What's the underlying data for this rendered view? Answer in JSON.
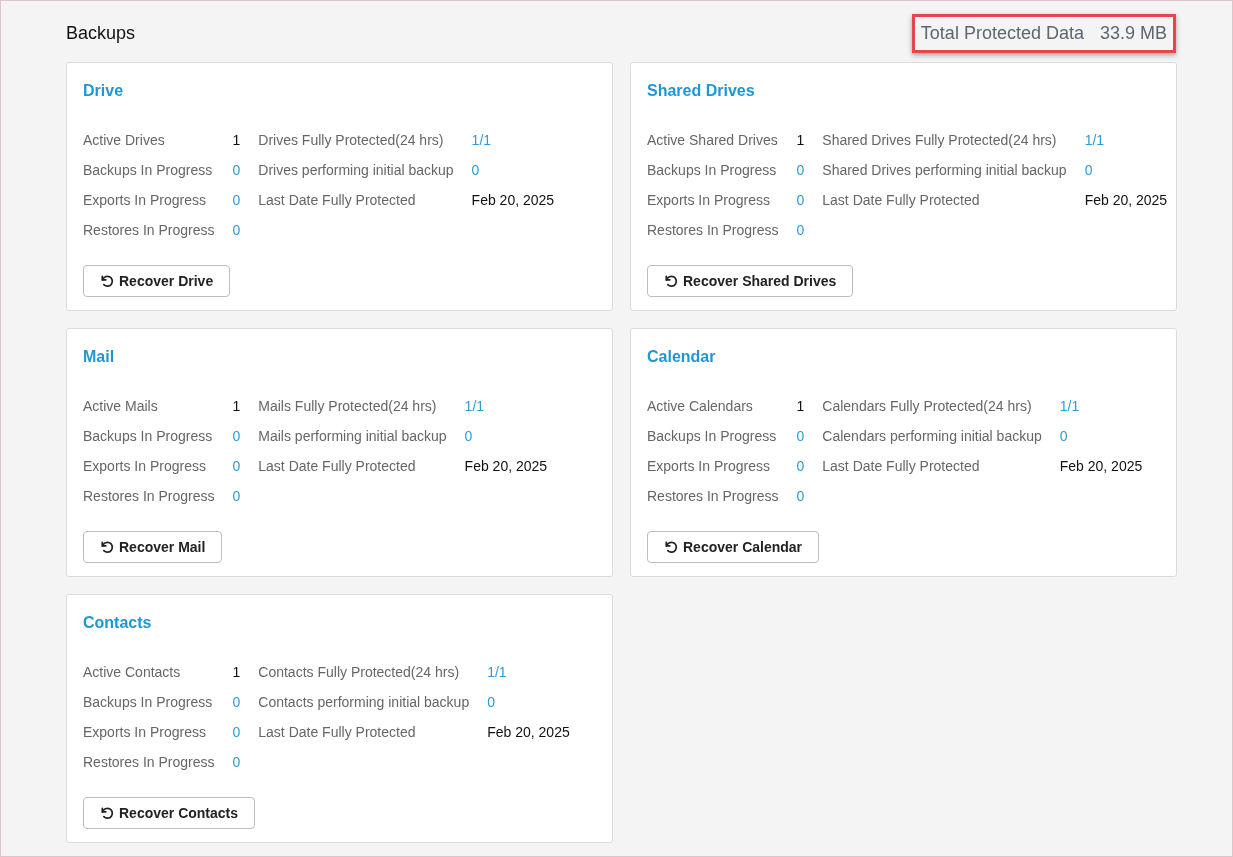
{
  "page_title": "Backups",
  "total": {
    "label": "Total Protected Data",
    "value": "33.9 MB",
    "highlighted": true
  },
  "cards": [
    {
      "title": "Drive",
      "left": [
        {
          "label": "Active Drives",
          "value": "1",
          "kind": "plain"
        },
        {
          "label": "Backups In Progress",
          "value": "0",
          "kind": "link"
        },
        {
          "label": "Exports In Progress",
          "value": "0",
          "kind": "link"
        },
        {
          "label": "Restores In Progress",
          "value": "0",
          "kind": "link"
        }
      ],
      "right": [
        {
          "label": "Drives Fully Protected(24 hrs)",
          "value": "1/1",
          "kind": "link"
        },
        {
          "label": "Drives performing initial backup",
          "value": "0",
          "kind": "link"
        },
        {
          "label": "Last Date Fully Protected",
          "value": "Feb 20, 2025",
          "kind": "plain"
        }
      ],
      "button": "Recover Drive"
    },
    {
      "title": "Shared Drives",
      "left": [
        {
          "label": "Active Shared Drives",
          "value": "1",
          "kind": "plain"
        },
        {
          "label": "Backups In Progress",
          "value": "0",
          "kind": "link"
        },
        {
          "label": "Exports In Progress",
          "value": "0",
          "kind": "link"
        },
        {
          "label": "Restores In Progress",
          "value": "0",
          "kind": "link"
        }
      ],
      "right": [
        {
          "label": "Shared Drives Fully Protected(24 hrs)",
          "value": "1/1",
          "kind": "link"
        },
        {
          "label": "Shared Drives performing initial backup",
          "value": "0",
          "kind": "link"
        },
        {
          "label": "Last Date Fully Protected",
          "value": "Feb 20, 2025",
          "kind": "plain"
        }
      ],
      "button": "Recover Shared Drives"
    },
    {
      "title": "Mail",
      "left": [
        {
          "label": "Active Mails",
          "value": "1",
          "kind": "plain"
        },
        {
          "label": "Backups In Progress",
          "value": "0",
          "kind": "link"
        },
        {
          "label": "Exports In Progress",
          "value": "0",
          "kind": "link"
        },
        {
          "label": "Restores In Progress",
          "value": "0",
          "kind": "link"
        }
      ],
      "right": [
        {
          "label": "Mails Fully Protected(24 hrs)",
          "value": "1/1",
          "kind": "link"
        },
        {
          "label": "Mails performing initial backup",
          "value": "0",
          "kind": "link"
        },
        {
          "label": "Last Date Fully Protected",
          "value": "Feb 20, 2025",
          "kind": "plain"
        }
      ],
      "button": "Recover Mail"
    },
    {
      "title": "Calendar",
      "left": [
        {
          "label": "Active Calendars",
          "value": "1",
          "kind": "plain"
        },
        {
          "label": "Backups In Progress",
          "value": "0",
          "kind": "link"
        },
        {
          "label": "Exports In Progress",
          "value": "0",
          "kind": "link"
        },
        {
          "label": "Restores In Progress",
          "value": "0",
          "kind": "link"
        }
      ],
      "right": [
        {
          "label": "Calendars Fully Protected(24 hrs)",
          "value": "1/1",
          "kind": "link"
        },
        {
          "label": "Calendars performing initial backup",
          "value": "0",
          "kind": "link"
        },
        {
          "label": "Last Date Fully Protected",
          "value": "Feb 20, 2025",
          "kind": "plain"
        }
      ],
      "button": "Recover Calendar"
    },
    {
      "title": "Contacts",
      "left": [
        {
          "label": "Active Contacts",
          "value": "1",
          "kind": "plain"
        },
        {
          "label": "Backups In Progress",
          "value": "0",
          "kind": "link"
        },
        {
          "label": "Exports In Progress",
          "value": "0",
          "kind": "link"
        },
        {
          "label": "Restores In Progress",
          "value": "0",
          "kind": "link"
        }
      ],
      "right": [
        {
          "label": "Contacts Fully Protected(24 hrs)",
          "value": "1/1",
          "kind": "link"
        },
        {
          "label": "Contacts performing initial backup",
          "value": "0",
          "kind": "link"
        },
        {
          "label": "Last Date Fully Protected",
          "value": "Feb 20, 2025",
          "kind": "plain"
        }
      ],
      "button": "Recover Contacts"
    }
  ]
}
